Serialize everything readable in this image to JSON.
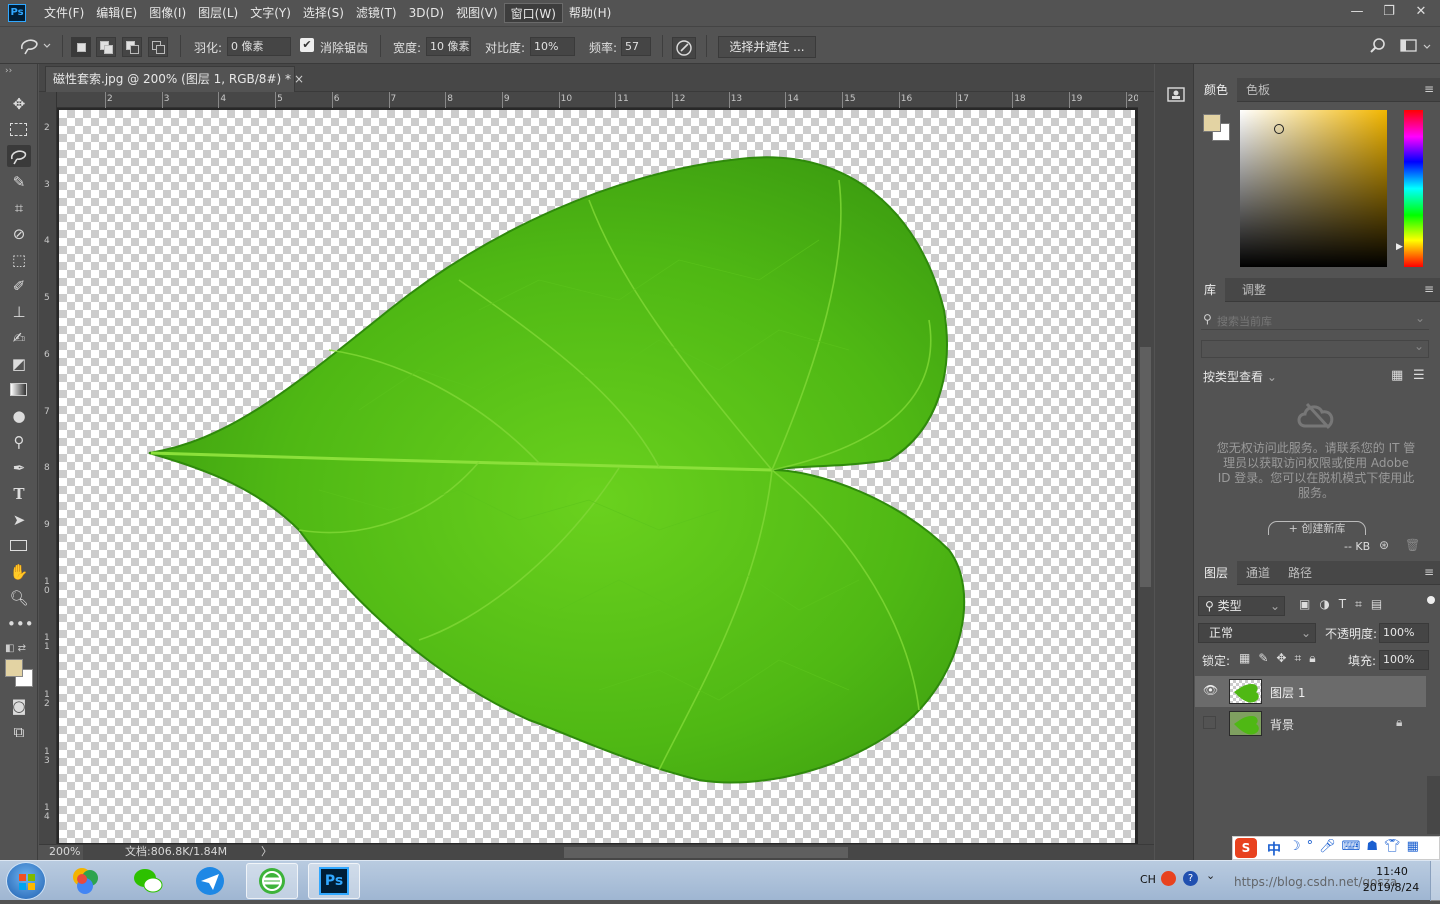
{
  "menubar": {
    "logo": "Ps",
    "items": [
      "文件(F)",
      "编辑(E)",
      "图像(I)",
      "图层(L)",
      "文字(Y)",
      "选择(S)",
      "滤镜(T)",
      "3D(D)",
      "视图(V)",
      "窗口(W)",
      "帮助(H)"
    ],
    "active_index": 9,
    "window_buttons": [
      "—",
      "❐",
      "✕"
    ]
  },
  "options": {
    "feather_label": "羽化:",
    "feather_value": "0 像素",
    "antialias_label": "消除锯齿",
    "antialias_checked": true,
    "width_label": "宽度:",
    "width_value": "10 像素",
    "contrast_label": "对比度:",
    "contrast_value": "10%",
    "frequency_label": "频率:",
    "frequency_value": "57",
    "refine_label": "选择并遮住 ..."
  },
  "document": {
    "tab_title": "磁性套索.jpg @ 200% (图层 1, RGB/8#) *",
    "close": "×",
    "ruler_top": [
      "2",
      "3",
      "4",
      "5",
      "6",
      "7",
      "8",
      "9",
      "10",
      "11",
      "12",
      "13",
      "14",
      "15",
      "16",
      "17",
      "18",
      "19",
      "20"
    ],
    "ruler_left": [
      "2",
      "3",
      "4",
      "5",
      "6",
      "7",
      "8",
      "9",
      "1 0",
      "1 1",
      "1 2",
      "1 3",
      "1 4"
    ],
    "zoom": "200%",
    "doc_info": "文档:806.8K/1.84M",
    "status_arrow": "〉"
  },
  "color_panel": {
    "tabs": [
      "颜色",
      "色板"
    ],
    "foreground": "#e3d3a3",
    "background": "#ffffff",
    "hue_color": "#f2b600"
  },
  "library_panel": {
    "tabs": [
      "库",
      "调整"
    ],
    "search_placeholder": "搜索当前库",
    "view_label": "按类型查看",
    "message": "您无权访问此服务。请联系您的 IT 管理员以获取访问权限或使用 Adobe ID 登录。您可以在脱机模式下使用此服务。",
    "create_button": "+ 创建新库",
    "size_label": "-- KB"
  },
  "layers_panel": {
    "tabs": [
      "图层",
      "通道",
      "路径"
    ],
    "filter_label": "类型",
    "blend_mode": "正常",
    "opacity_label": "不透明度:",
    "opacity_value": "100%",
    "lock_label": "锁定:",
    "fill_label": "填充:",
    "fill_value": "100%",
    "layers": [
      {
        "name": "图层 1",
        "visible": true,
        "selected": true,
        "locked": false
      },
      {
        "name": "背景",
        "visible": false,
        "selected": false,
        "locked": true
      }
    ]
  },
  "tools": [
    "move-tool",
    "marquee-tool",
    "magnetic-lasso-tool",
    "magic-wand-tool",
    "crop-tool",
    "eyedropper-tool",
    "patch-tool",
    "brush-tool",
    "stamp-tool",
    "history-brush-tool",
    "eraser-tool",
    "gradient-tool",
    "blur-tool",
    "dodge-tool",
    "pen-tool",
    "type-tool",
    "path-select-tool",
    "rectangle-tool",
    "hand-tool",
    "zoom-tool",
    "more-tools"
  ],
  "foreground_swatch": "#e3d3a3",
  "taskbar": {
    "apps": [
      "start",
      "360",
      "wechat",
      "feishu",
      "browser",
      "photoshop"
    ],
    "ps_label": "Ps",
    "tray_lang": "CH",
    "time": "11:40",
    "date": "2019/8/24",
    "watermark": "https://blog.csdn.net/gosza"
  },
  "ime_bar": {
    "label": "中"
  }
}
